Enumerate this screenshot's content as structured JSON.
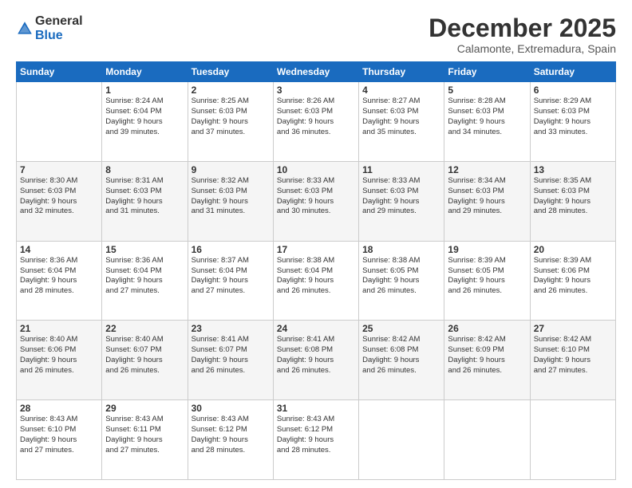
{
  "header": {
    "logo_general": "General",
    "logo_blue": "Blue",
    "month_title": "December 2025",
    "subtitle": "Calamonte, Extremadura, Spain"
  },
  "days_of_week": [
    "Sunday",
    "Monday",
    "Tuesday",
    "Wednesday",
    "Thursday",
    "Friday",
    "Saturday"
  ],
  "weeks": [
    [
      {
        "day": "",
        "info": ""
      },
      {
        "day": "1",
        "info": "Sunrise: 8:24 AM\nSunset: 6:04 PM\nDaylight: 9 hours\nand 39 minutes."
      },
      {
        "day": "2",
        "info": "Sunrise: 8:25 AM\nSunset: 6:03 PM\nDaylight: 9 hours\nand 37 minutes."
      },
      {
        "day": "3",
        "info": "Sunrise: 8:26 AM\nSunset: 6:03 PM\nDaylight: 9 hours\nand 36 minutes."
      },
      {
        "day": "4",
        "info": "Sunrise: 8:27 AM\nSunset: 6:03 PM\nDaylight: 9 hours\nand 35 minutes."
      },
      {
        "day": "5",
        "info": "Sunrise: 8:28 AM\nSunset: 6:03 PM\nDaylight: 9 hours\nand 34 minutes."
      },
      {
        "day": "6",
        "info": "Sunrise: 8:29 AM\nSunset: 6:03 PM\nDaylight: 9 hours\nand 33 minutes."
      }
    ],
    [
      {
        "day": "7",
        "info": "Sunrise: 8:30 AM\nSunset: 6:03 PM\nDaylight: 9 hours\nand 32 minutes."
      },
      {
        "day": "8",
        "info": "Sunrise: 8:31 AM\nSunset: 6:03 PM\nDaylight: 9 hours\nand 31 minutes."
      },
      {
        "day": "9",
        "info": "Sunrise: 8:32 AM\nSunset: 6:03 PM\nDaylight: 9 hours\nand 31 minutes."
      },
      {
        "day": "10",
        "info": "Sunrise: 8:33 AM\nSunset: 6:03 PM\nDaylight: 9 hours\nand 30 minutes."
      },
      {
        "day": "11",
        "info": "Sunrise: 8:33 AM\nSunset: 6:03 PM\nDaylight: 9 hours\nand 29 minutes."
      },
      {
        "day": "12",
        "info": "Sunrise: 8:34 AM\nSunset: 6:03 PM\nDaylight: 9 hours\nand 29 minutes."
      },
      {
        "day": "13",
        "info": "Sunrise: 8:35 AM\nSunset: 6:03 PM\nDaylight: 9 hours\nand 28 minutes."
      }
    ],
    [
      {
        "day": "14",
        "info": "Sunrise: 8:36 AM\nSunset: 6:04 PM\nDaylight: 9 hours\nand 28 minutes."
      },
      {
        "day": "15",
        "info": "Sunrise: 8:36 AM\nSunset: 6:04 PM\nDaylight: 9 hours\nand 27 minutes."
      },
      {
        "day": "16",
        "info": "Sunrise: 8:37 AM\nSunset: 6:04 PM\nDaylight: 9 hours\nand 27 minutes."
      },
      {
        "day": "17",
        "info": "Sunrise: 8:38 AM\nSunset: 6:04 PM\nDaylight: 9 hours\nand 26 minutes."
      },
      {
        "day": "18",
        "info": "Sunrise: 8:38 AM\nSunset: 6:05 PM\nDaylight: 9 hours\nand 26 minutes."
      },
      {
        "day": "19",
        "info": "Sunrise: 8:39 AM\nSunset: 6:05 PM\nDaylight: 9 hours\nand 26 minutes."
      },
      {
        "day": "20",
        "info": "Sunrise: 8:39 AM\nSunset: 6:06 PM\nDaylight: 9 hours\nand 26 minutes."
      }
    ],
    [
      {
        "day": "21",
        "info": "Sunrise: 8:40 AM\nSunset: 6:06 PM\nDaylight: 9 hours\nand 26 minutes."
      },
      {
        "day": "22",
        "info": "Sunrise: 8:40 AM\nSunset: 6:07 PM\nDaylight: 9 hours\nand 26 minutes."
      },
      {
        "day": "23",
        "info": "Sunrise: 8:41 AM\nSunset: 6:07 PM\nDaylight: 9 hours\nand 26 minutes."
      },
      {
        "day": "24",
        "info": "Sunrise: 8:41 AM\nSunset: 6:08 PM\nDaylight: 9 hours\nand 26 minutes."
      },
      {
        "day": "25",
        "info": "Sunrise: 8:42 AM\nSunset: 6:08 PM\nDaylight: 9 hours\nand 26 minutes."
      },
      {
        "day": "26",
        "info": "Sunrise: 8:42 AM\nSunset: 6:09 PM\nDaylight: 9 hours\nand 26 minutes."
      },
      {
        "day": "27",
        "info": "Sunrise: 8:42 AM\nSunset: 6:10 PM\nDaylight: 9 hours\nand 27 minutes."
      }
    ],
    [
      {
        "day": "28",
        "info": "Sunrise: 8:43 AM\nSunset: 6:10 PM\nDaylight: 9 hours\nand 27 minutes."
      },
      {
        "day": "29",
        "info": "Sunrise: 8:43 AM\nSunset: 6:11 PM\nDaylight: 9 hours\nand 27 minutes."
      },
      {
        "day": "30",
        "info": "Sunrise: 8:43 AM\nSunset: 6:12 PM\nDaylight: 9 hours\nand 28 minutes."
      },
      {
        "day": "31",
        "info": "Sunrise: 8:43 AM\nSunset: 6:12 PM\nDaylight: 9 hours\nand 28 minutes."
      },
      {
        "day": "",
        "info": ""
      },
      {
        "day": "",
        "info": ""
      },
      {
        "day": "",
        "info": ""
      }
    ]
  ]
}
